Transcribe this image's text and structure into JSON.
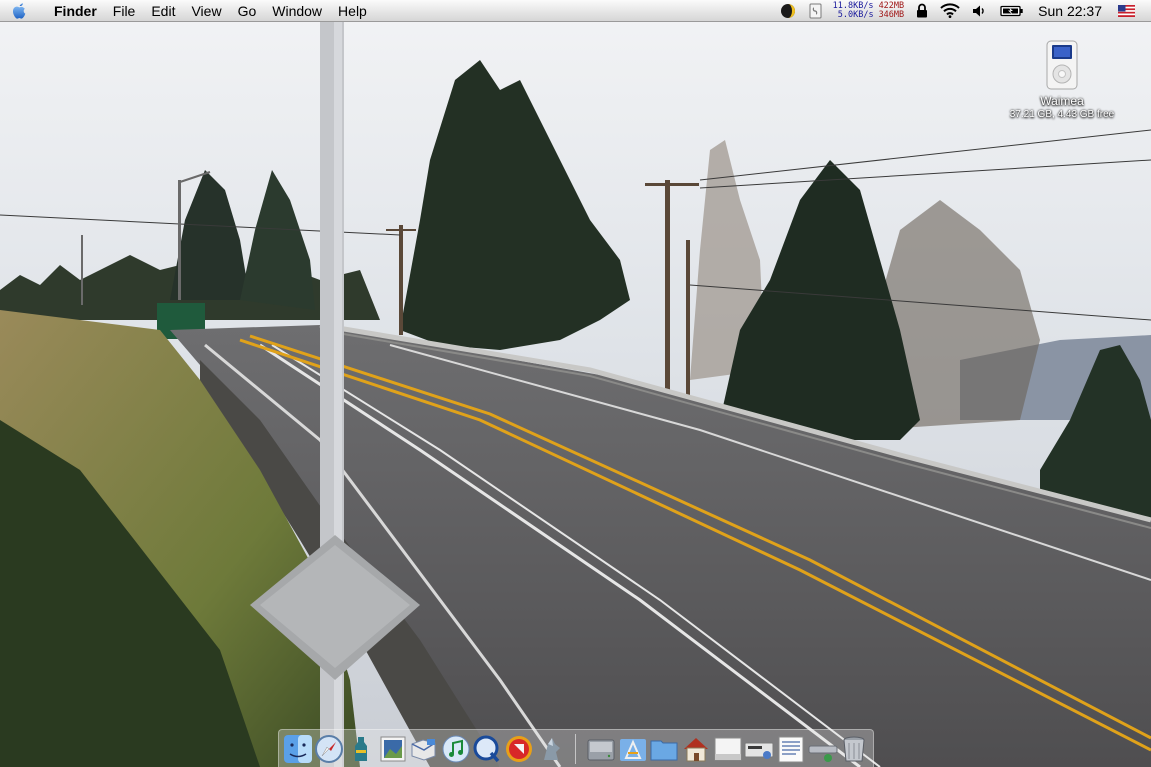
{
  "menubar": {
    "app_name": "Finder",
    "menus": [
      "File",
      "Edit",
      "View",
      "Go",
      "Window",
      "Help"
    ],
    "net_up": "11.8KB/s",
    "net_down": "5.0KB/s",
    "mem_used": "422MB",
    "mem_free": "346MB",
    "clock": "Sun 22:37",
    "status_icons": [
      "moon-phase-icon",
      "script-icon",
      "lock-icon",
      "wifi-icon",
      "volume-icon",
      "battery-icon",
      "us-flag-icon"
    ]
  },
  "desktop": {
    "wallpaper": "road-photo",
    "drive": {
      "name": "Waimea",
      "info": "37.21 GB, 4.43 GB free",
      "icon": "ipod-drive-icon"
    }
  },
  "dock": {
    "apps": [
      "finder",
      "safari",
      "system-utility",
      "preview",
      "mail",
      "itunes",
      "quicktime",
      "presentation",
      "fetch"
    ],
    "docs": [
      "hard-drive",
      "applications-folder",
      "documents-folder",
      "home-folder",
      "disk",
      "network-volume",
      "text-document",
      "drive-volume",
      "trash"
    ]
  },
  "colors": {
    "menubar_bg": "#e6e6e6",
    "sky": "#d8dde3",
    "road": "#5c5b5d",
    "center_line": "#e0a21a",
    "grass": "#8a7a44"
  }
}
